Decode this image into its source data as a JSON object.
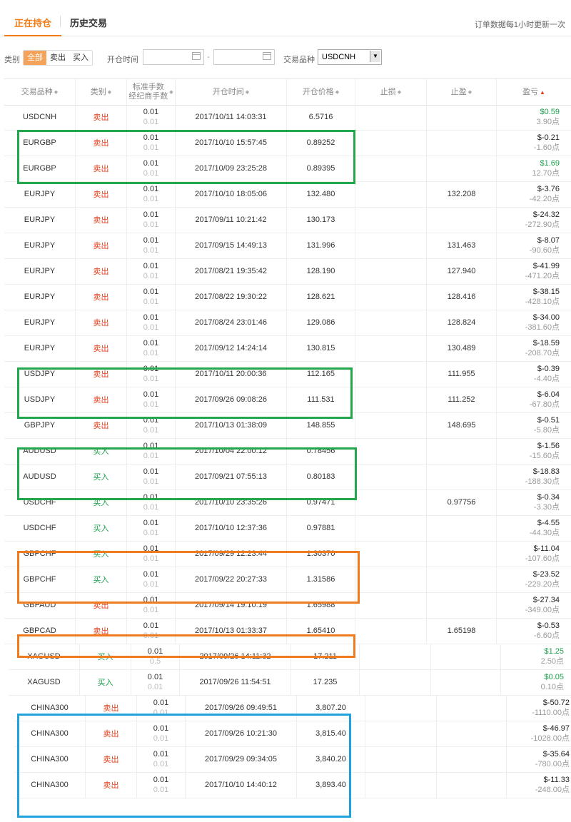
{
  "tabs": {
    "active": "正在持仓",
    "inactive": "历史交易"
  },
  "update_note": "订单数据每1小时更新一次",
  "filter": {
    "type_label": "类别",
    "types": [
      "全部",
      "卖出",
      "买入"
    ],
    "open_time_label": "开仓时间",
    "dash": "-",
    "symbol_label": "交易品种",
    "symbol_value": "USDCNH"
  },
  "headers": {
    "symbol": "交易品种",
    "type": "类别",
    "fee1": "标准手数",
    "fee2": "经纪商手数",
    "open_time": "开仓时间",
    "open_price": "开仓价格",
    "stop_loss": "止损",
    "take_profit": "止盈",
    "pl": "盈亏"
  },
  "rows": [
    {
      "symbol": "USDCNH",
      "type": "卖出",
      "fee_a": "0.01",
      "fee_b": "0.01",
      "time": "2017/10/11 14:03:31",
      "price": "6.5716",
      "sl": "",
      "tp": "",
      "pl": "$0.59",
      "pts": "3.90点",
      "pl_pos": true
    },
    {
      "symbol": "EURGBP",
      "type": "卖出",
      "fee_a": "0.01",
      "fee_b": "0.01",
      "time": "2017/10/10 15:57:45",
      "price": "0.89252",
      "sl": "",
      "tp": "",
      "pl": "$-0.21",
      "pts": "-1.60点",
      "pl_pos": false
    },
    {
      "symbol": "EURGBP",
      "type": "卖出",
      "fee_a": "0.01",
      "fee_b": "0.01",
      "time": "2017/10/09 23:25:28",
      "price": "0.89395",
      "sl": "",
      "tp": "",
      "pl": "$1.69",
      "pts": "12.70点",
      "pl_pos": true
    },
    {
      "symbol": "EURJPY",
      "type": "卖出",
      "fee_a": "0.01",
      "fee_b": "0.01",
      "time": "2017/10/10 18:05:06",
      "price": "132.480",
      "sl": "",
      "tp": "132.208",
      "pl": "$-3.76",
      "pts": "-42.20点",
      "pl_pos": false
    },
    {
      "symbol": "EURJPY",
      "type": "卖出",
      "fee_a": "0.01",
      "fee_b": "0.01",
      "time": "2017/09/11 10:21:42",
      "price": "130.173",
      "sl": "",
      "tp": "",
      "pl": "$-24.32",
      "pts": "-272.90点",
      "pl_pos": false
    },
    {
      "symbol": "EURJPY",
      "type": "卖出",
      "fee_a": "0.01",
      "fee_b": "0.01",
      "time": "2017/09/15 14:49:13",
      "price": "131.996",
      "sl": "",
      "tp": "131.463",
      "pl": "$-8.07",
      "pts": "-90.60点",
      "pl_pos": false
    },
    {
      "symbol": "EURJPY",
      "type": "卖出",
      "fee_a": "0.01",
      "fee_b": "0.01",
      "time": "2017/08/21 19:35:42",
      "price": "128.190",
      "sl": "",
      "tp": "127.940",
      "pl": "$-41.99",
      "pts": "-471.20点",
      "pl_pos": false
    },
    {
      "symbol": "EURJPY",
      "type": "卖出",
      "fee_a": "0.01",
      "fee_b": "0.01",
      "time": "2017/08/22 19:30:22",
      "price": "128.621",
      "sl": "",
      "tp": "128.416",
      "pl": "$-38.15",
      "pts": "-428.10点",
      "pl_pos": false
    },
    {
      "symbol": "EURJPY",
      "type": "卖出",
      "fee_a": "0.01",
      "fee_b": "0.01",
      "time": "2017/08/24 23:01:46",
      "price": "129.086",
      "sl": "",
      "tp": "128.824",
      "pl": "$-34.00",
      "pts": "-381.60点",
      "pl_pos": false
    },
    {
      "symbol": "EURJPY",
      "type": "卖出",
      "fee_a": "0.01",
      "fee_b": "0.01",
      "time": "2017/09/12 14:24:14",
      "price": "130.815",
      "sl": "",
      "tp": "130.489",
      "pl": "$-18.59",
      "pts": "-208.70点",
      "pl_pos": false
    },
    {
      "symbol": "USDJPY",
      "type": "卖出",
      "fee_a": "0.01",
      "fee_b": "0.01",
      "time": "2017/10/11 20:00:36",
      "price": "112.165",
      "sl": "",
      "tp": "111.955",
      "pl": "$-0.39",
      "pts": "-4.40点",
      "pl_pos": false
    },
    {
      "symbol": "USDJPY",
      "type": "卖出",
      "fee_a": "0.01",
      "fee_b": "0.01",
      "time": "2017/09/26 09:08:26",
      "price": "111.531",
      "sl": "",
      "tp": "111.252",
      "pl": "$-6.04",
      "pts": "-67.80点",
      "pl_pos": false
    },
    {
      "symbol": "GBPJPY",
      "type": "卖出",
      "fee_a": "0.01",
      "fee_b": "0.01",
      "time": "2017/10/13 01:38:09",
      "price": "148.855",
      "sl": "",
      "tp": "148.695",
      "pl": "$-0.51",
      "pts": "-5.80点",
      "pl_pos": false
    },
    {
      "symbol": "AUDUSD",
      "type": "买入",
      "fee_a": "0.01",
      "fee_b": "0.01",
      "time": "2017/10/04 22:00:12",
      "price": "0.78456",
      "sl": "",
      "tp": "",
      "pl": "$-1.56",
      "pts": "-15.60点",
      "pl_pos": false
    },
    {
      "symbol": "AUDUSD",
      "type": "买入",
      "fee_a": "0.01",
      "fee_b": "0.01",
      "time": "2017/09/21 07:55:13",
      "price": "0.80183",
      "sl": "",
      "tp": "",
      "pl": "$-18.83",
      "pts": "-188.30点",
      "pl_pos": false
    },
    {
      "symbol": "USDCHF",
      "type": "买入",
      "fee_a": "0.01",
      "fee_b": "0.01",
      "time": "2017/10/10 23:35:26",
      "price": "0.97471",
      "sl": "",
      "tp": "0.97756",
      "pl": "$-0.34",
      "pts": "-3.30点",
      "pl_pos": false
    },
    {
      "symbol": "USDCHF",
      "type": "买入",
      "fee_a": "0.01",
      "fee_b": "0.01",
      "time": "2017/10/10 12:37:36",
      "price": "0.97881",
      "sl": "",
      "tp": "",
      "pl": "$-4.55",
      "pts": "-44.30点",
      "pl_pos": false
    },
    {
      "symbol": "GBPCHF",
      "type": "买入",
      "fee_a": "0.01",
      "fee_b": "0.01",
      "time": "2017/09/29 12:23:44",
      "price": "1.30370",
      "sl": "",
      "tp": "",
      "pl": "$-11.04",
      "pts": "-107.60点",
      "pl_pos": false
    },
    {
      "symbol": "GBPCHF",
      "type": "买入",
      "fee_a": "0.01",
      "fee_b": "0.01",
      "time": "2017/09/22 20:27:33",
      "price": "1.31586",
      "sl": "",
      "tp": "",
      "pl": "$-23.52",
      "pts": "-229.20点",
      "pl_pos": false
    },
    {
      "symbol": "GBPAUD",
      "type": "卖出",
      "fee_a": "0.01",
      "fee_b": "0.01",
      "time": "2017/09/14 19:10:19",
      "price": "1.65988",
      "sl": "",
      "tp": "",
      "pl": "$-27.34",
      "pts": "-349.00点",
      "pl_pos": false
    },
    {
      "symbol": "GBPCAD",
      "type": "卖出",
      "fee_a": "0.01",
      "fee_b": "0.01",
      "time": "2017/10/13 01:33:37",
      "price": "1.65410",
      "sl": "",
      "tp": "1.65198",
      "pl": "$-0.53",
      "pts": "-6.60点",
      "pl_pos": false
    },
    {
      "symbol": "XAGUSD",
      "type": "买入",
      "fee_a": "0.01",
      "fee_b": "0.5",
      "time": "2017/09/26 14:11:32",
      "price": "17.211",
      "sl": "",
      "tp": "",
      "pl": "$1.25",
      "pts": "2.50点",
      "pl_pos": true
    },
    {
      "symbol": "XAGUSD",
      "type": "买入",
      "fee_a": "0.01",
      "fee_b": "0.01",
      "time": "2017/09/26 11:54:51",
      "price": "17.235",
      "sl": "",
      "tp": "",
      "pl": "$0.05",
      "pts": "0.10点",
      "pl_pos": true
    },
    {
      "symbol": "CHINA300",
      "type": "卖出",
      "fee_a": "0.01",
      "fee_b": "0.01",
      "time": "2017/09/26 09:49:51",
      "price": "3,807.20",
      "sl": "",
      "tp": "",
      "pl": "$-50.72",
      "pts": "-1110.00点",
      "pl_pos": false
    },
    {
      "symbol": "CHINA300",
      "type": "卖出",
      "fee_a": "0.01",
      "fee_b": "0.01",
      "time": "2017/09/26 10:21:30",
      "price": "3,815.40",
      "sl": "",
      "tp": "",
      "pl": "$-46.97",
      "pts": "-1028.00点",
      "pl_pos": false
    },
    {
      "symbol": "CHINA300",
      "type": "卖出",
      "fee_a": "0.01",
      "fee_b": "0.01",
      "time": "2017/09/29 09:34:05",
      "price": "3,840.20",
      "sl": "",
      "tp": "",
      "pl": "$-35.64",
      "pts": "-780.00点",
      "pl_pos": false
    },
    {
      "symbol": "CHINA300",
      "type": "卖出",
      "fee_a": "0.01",
      "fee_b": "0.01",
      "time": "2017/10/10 14:40:12",
      "price": "3,893.40",
      "sl": "",
      "tp": "",
      "pl": "$-11.33",
      "pts": "-248.00点",
      "pl_pos": false
    }
  ],
  "colors": {
    "accent": "#f07a14",
    "sell": "#e2401c",
    "buy": "#1a9f4b",
    "box_green": "#22a84a",
    "box_orange": "#f07a1e",
    "box_blue": "#1fa3dd"
  }
}
